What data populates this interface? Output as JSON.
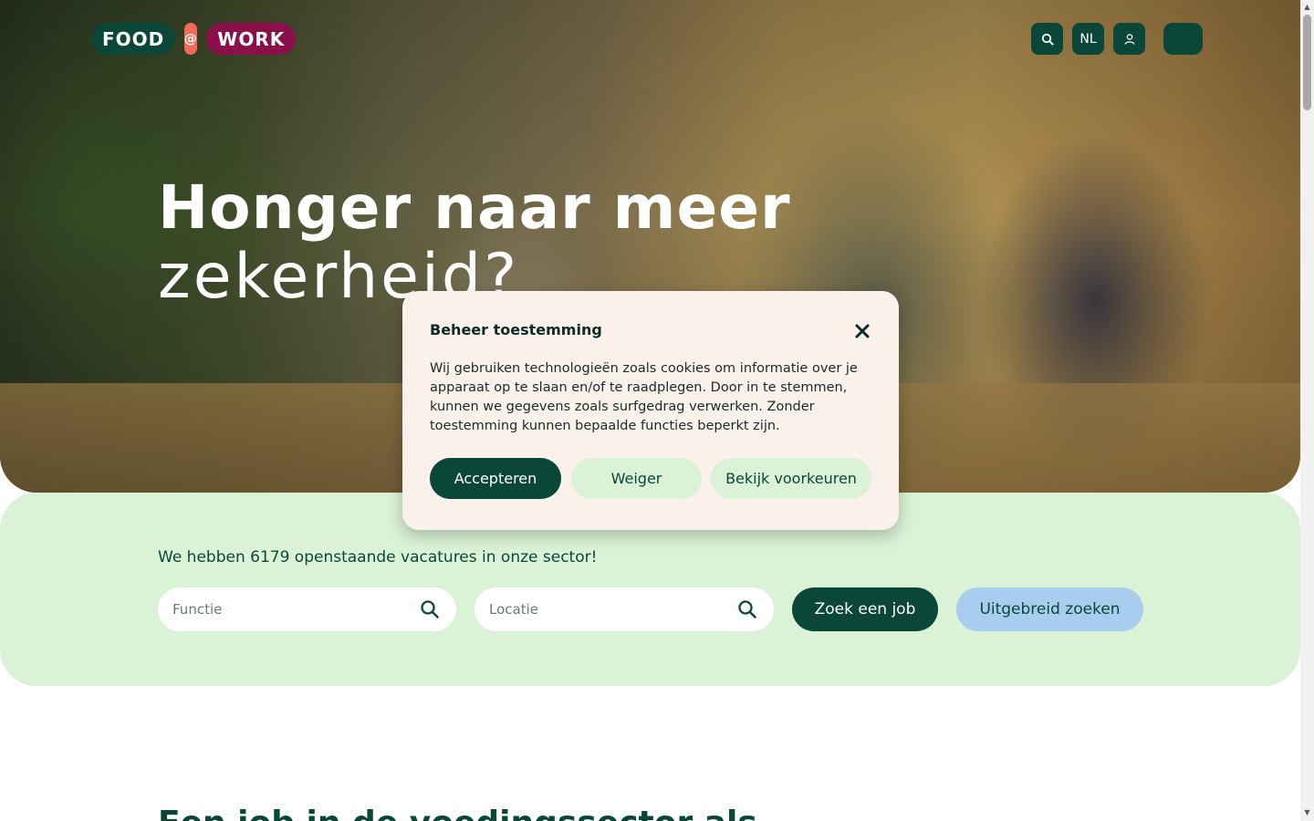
{
  "header": {
    "logo": {
      "food": "FOOD",
      "at": "@",
      "work": "WORK"
    },
    "language": "NL",
    "icons": {
      "search": "search-icon",
      "account": "user-icon",
      "menu": "menu-icon"
    }
  },
  "hero": {
    "title_line1": "Honger naar meer",
    "title_line2": "zekerheid?"
  },
  "search": {
    "count_text": "We hebben 6179 openstaande vacatures in onze sector!",
    "function_placeholder": "Functie",
    "location_placeholder": "Locatie",
    "search_button": "Zoek een job",
    "advanced_button": "Uitgebreid zoeken"
  },
  "section": {
    "title": "Een job in de voedingssector als"
  },
  "cookie_modal": {
    "title": "Beheer toestemming",
    "body": "Wij gebruiken technologieën zoals cookies om informatie over je apparaat op te slaan en/of te raadplegen. Door in te stemmen, kunnen we gegevens zoals surfgedrag verwerken. Zonder toestemming kunnen bepaalde functies beperkt zijn.",
    "accept": "Accepteren",
    "deny": "Weiger",
    "preferences": "Bekijk voorkeuren"
  },
  "colors": {
    "brand_green": "#0b4739",
    "brand_red": "#8a0f4a",
    "accent_coral": "#f26a5a",
    "mint": "#daf3d6",
    "light_blue": "#a9cdee",
    "modal_bg": "#f9f1ea"
  }
}
